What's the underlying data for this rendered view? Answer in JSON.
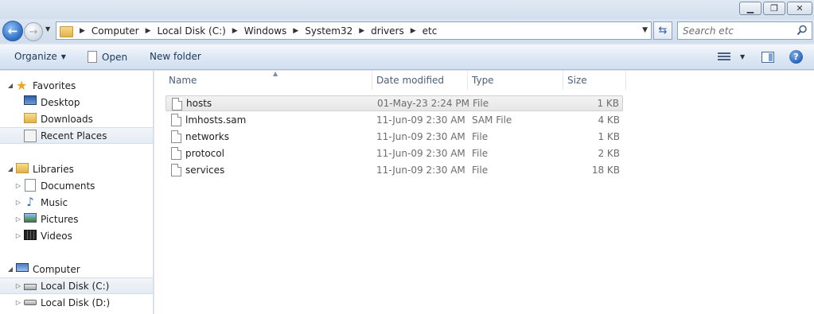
{
  "window": {
    "controls": [
      "minimize",
      "maximize",
      "close"
    ]
  },
  "address": {
    "crumbs": [
      "Computer",
      "Local Disk (C:)",
      "Windows",
      "System32",
      "drivers",
      "etc"
    ]
  },
  "search": {
    "placeholder": "Search etc"
  },
  "toolbar": {
    "organize_label": "Organize",
    "open_label": "Open",
    "new_folder_label": "New folder"
  },
  "sidebar": {
    "favorites": {
      "label": "Favorites",
      "items": [
        {
          "label": "Desktop",
          "icon": "desktop-icon"
        },
        {
          "label": "Downloads",
          "icon": "downloads-folder-icon"
        },
        {
          "label": "Recent Places",
          "icon": "recent-places-icon",
          "selected": true
        }
      ]
    },
    "libraries": {
      "label": "Libraries",
      "items": [
        {
          "label": "Documents",
          "icon": "documents-icon"
        },
        {
          "label": "Music",
          "icon": "music-icon"
        },
        {
          "label": "Pictures",
          "icon": "pictures-icon"
        },
        {
          "label": "Videos",
          "icon": "videos-icon"
        }
      ]
    },
    "computer": {
      "label": "Computer",
      "items": [
        {
          "label": "Local Disk (C:)",
          "icon": "disk-c-icon",
          "selected": true
        },
        {
          "label": "Local Disk (D:)",
          "icon": "disk-d-icon"
        }
      ]
    }
  },
  "columns": {
    "name": "Name",
    "date": "Date modified",
    "type": "Type",
    "size": "Size"
  },
  "files": [
    {
      "name": "hosts",
      "date": "01-May-23 2:24 PM",
      "type": "File",
      "size": "1 KB",
      "selected": true
    },
    {
      "name": "lmhosts.sam",
      "date": "11-Jun-09 2:30 AM",
      "type": "SAM File",
      "size": "4 KB"
    },
    {
      "name": "networks",
      "date": "11-Jun-09 2:30 AM",
      "type": "File",
      "size": "1 KB"
    },
    {
      "name": "protocol",
      "date": "11-Jun-09 2:30 AM",
      "type": "File",
      "size": "2 KB"
    },
    {
      "name": "services",
      "date": "11-Jun-09 2:30 AM",
      "type": "File",
      "size": "18 KB"
    }
  ],
  "colors": {
    "chrome_bg": "#dbe5f1",
    "toolbar_text": "#1e395b",
    "header_text": "#4c607a",
    "secondary_text": "#6d6d6d"
  }
}
